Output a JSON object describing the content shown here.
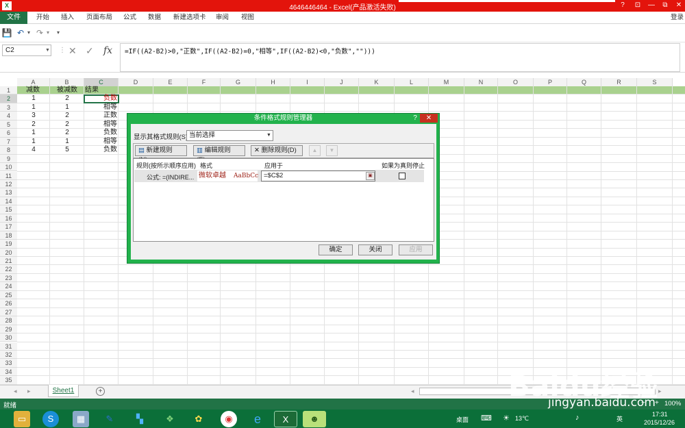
{
  "window": {
    "app_icon": "X",
    "title": "4646446464 - Excel(产品激活失败)",
    "help": "?",
    "restore_ribbon": "⊡",
    "minimize": "—",
    "maximize": "⧉",
    "close": "✕"
  },
  "ribbon": {
    "file": "文件",
    "tabs": [
      "开始",
      "插入",
      "页面布局",
      "公式",
      "数据",
      "新建选项卡",
      "审阅",
      "视图"
    ],
    "login": "登录"
  },
  "qat": {
    "save": "💾",
    "undo": "↶",
    "undo_dd": "▾",
    "redo": "↷",
    "redo_dd": "▾",
    "customize": "▾"
  },
  "formula_bar": {
    "name_box": "C2",
    "cancel": "✕",
    "enter": "✓",
    "fx": "fx",
    "formula": "=IF((A2-B2)>0,\"正数\",IF((A2-B2)=0,\"相等\",IF((A2-B2)<0,\"负数\",\"\")))"
  },
  "grid": {
    "columns": [
      "A",
      "B",
      "C",
      "D",
      "E",
      "F",
      "G",
      "H",
      "I",
      "J",
      "K",
      "L",
      "M",
      "N",
      "O",
      "P",
      "Q",
      "R",
      "S"
    ],
    "rows": [
      "1",
      "2",
      "3",
      "4",
      "5",
      "6",
      "7",
      "8",
      "9",
      "10",
      "11",
      "12",
      "13",
      "14",
      "15",
      "16",
      "17",
      "18",
      "19",
      "20",
      "21",
      "22",
      "23",
      "24",
      "25",
      "26",
      "27",
      "28",
      "29",
      "30",
      "31",
      "32",
      "33",
      "34",
      "35"
    ],
    "header_row": [
      "减数",
      "被减数",
      "结果"
    ],
    "data": [
      [
        "1",
        "2",
        "负数"
      ],
      [
        "1",
        "1",
        "相等"
      ],
      [
        "3",
        "2",
        "正数"
      ],
      [
        "2",
        "2",
        "相等"
      ],
      [
        "1",
        "2",
        "负数"
      ],
      [
        "1",
        "1",
        "相等"
      ],
      [
        "4",
        "5",
        "负数"
      ]
    ],
    "accent": "#a9d18e"
  },
  "sheets": {
    "nav_prev": "◂",
    "nav_next": "▸",
    "tab": "Sheet1",
    "add": "+",
    "scroll_left": "◂",
    "scroll_right": "▸"
  },
  "status": {
    "text": "就绪",
    "zoom_minus": "−",
    "zoom_plus": "+",
    "zoom": "100%"
  },
  "dialog": {
    "title": "条件格式规则管理器",
    "help": "?",
    "close": "✕",
    "show_label": "显示其格式规则(S):",
    "show_value": "当前选择",
    "new_rule": "新建规则(N)...",
    "edit_rule": "编辑规则(E)...",
    "delete_rule": "删除规则(D)",
    "move_up": "▲",
    "move_down": "▼",
    "col_rule": "规则(按所示顺序应用)",
    "col_format": "格式",
    "col_applies": "应用于",
    "col_stop": "如果为真则停止",
    "rule_name": "公式: =(INDIRE...",
    "format_sample_cn": "微软卓越",
    "format_sample_en": "AaBbCc",
    "applies_to": "=$C$2",
    "ok": "确定",
    "close_btn": "关闭",
    "apply": "应用"
  },
  "taskbar": {
    "desktop": "桌面",
    "temp": "13℃",
    "time": "17:31",
    "date": "2015/12/26",
    "ime": "英"
  },
  "watermark": {
    "logo": "Baidu经验",
    "url": "jingyan.baidu.com"
  }
}
